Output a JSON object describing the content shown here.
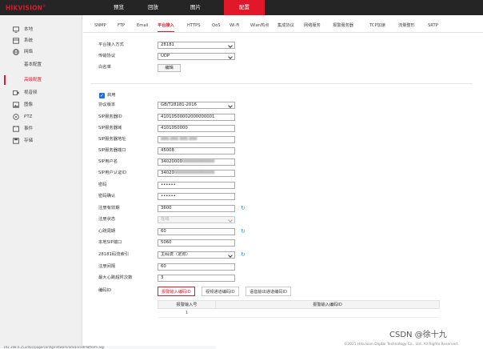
{
  "brand": {
    "name": "HIKVISION",
    "mark": "®"
  },
  "topnav": [
    "预览",
    "回放",
    "图片",
    "配置"
  ],
  "sidebar": {
    "items": [
      {
        "label": "本地",
        "icon": "monitor-icon"
      },
      {
        "label": "系统",
        "icon": "system-icon"
      },
      {
        "label": "网络",
        "icon": "globe-icon"
      },
      {
        "label": "视音频",
        "icon": "video-icon"
      },
      {
        "label": "图像",
        "icon": "image-icon"
      },
      {
        "label": "PTZ",
        "icon": "ptz-icon"
      },
      {
        "label": "事件",
        "icon": "event-icon"
      },
      {
        "label": "存储",
        "icon": "storage-icon"
      }
    ],
    "network_sub": [
      "基本配置",
      "高级配置"
    ]
  },
  "tabs": [
    "SNMP",
    "FTP",
    "Email",
    "平台接入",
    "HTTPS",
    "QoS",
    "Wi-Fi",
    "Wlan热点",
    "集成协议",
    "网络服务",
    "报警服务器",
    "TCP加速",
    "流量整形",
    "SRTP"
  ],
  "form_top": {
    "platform_label": "平台接入方式",
    "platform_value": "28181",
    "protocol_label": "传输协议",
    "protocol_value": "UDP",
    "whitelist_label": "白名单",
    "edit_button": "编辑"
  },
  "enable_label": "启用",
  "fields": [
    {
      "label": "协议版本",
      "value": "GB/T28181-2016"
    },
    {
      "label": "SIP服务器ID",
      "value": "41010500002000000001"
    },
    {
      "label": "SIP服务器域",
      "value": "4101050000"
    },
    {
      "label": "SIP服务器地址",
      "value": ""
    },
    {
      "label": "SIP服务器端口",
      "value": "45008"
    },
    {
      "label": "SIP用户名",
      "value": "34020000"
    },
    {
      "label": "SIP用户认证ID",
      "value": "34020"
    },
    {
      "label": "密码",
      "value": "••••••"
    },
    {
      "label": "密码确认",
      "value": "••••••"
    },
    {
      "label": "注册有效期",
      "value": "3600"
    },
    {
      "label": "注册状态",
      "value": "在线"
    },
    {
      "label": "心跳周期",
      "value": "60"
    },
    {
      "label": "本地SIP端口",
      "value": "5060"
    },
    {
      "label": "28181码流索引",
      "value": "主码流（定时）"
    },
    {
      "label": "注册间隔",
      "value": "60"
    },
    {
      "label": "最大心跳超时次数",
      "value": "3"
    }
  ],
  "encode_label": "编码ID",
  "subtabs": [
    "报警输入编码ID",
    "视频通道编码ID",
    "语音输出通道编码ID"
  ],
  "table": {
    "headers": [
      "报警输入号",
      "报警输入编码ID"
    ],
    "rows": [
      [
        "1",
        ""
      ]
    ]
  },
  "statusbar": "192.168.0.253/doc/page/config/network/advancedPlatform.asp",
  "copyright": "©2021 Hikvision Digital Technology Co., Ltd. All Rights Reserved.",
  "watermark": "CSDN @徐十九"
}
